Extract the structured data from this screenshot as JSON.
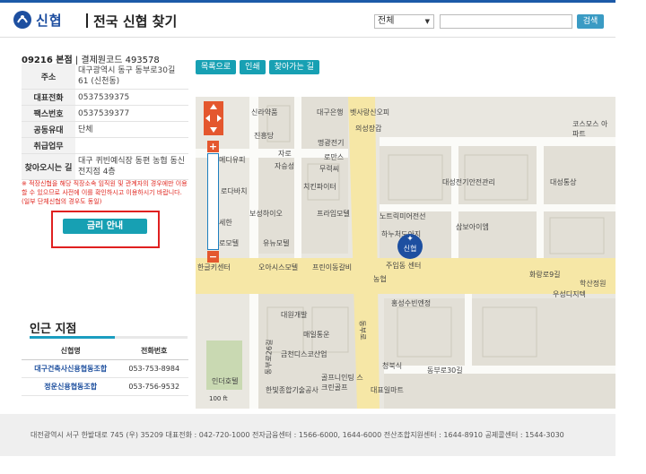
{
  "header": {
    "logo_text": "신협",
    "title": "전국 신협 찾기",
    "select_value": "전체",
    "search_button": "검색",
    "accent": "#1c5aa8"
  },
  "branch": {
    "code": "09216 본점",
    "bank_code_label": "결제원코드 493578",
    "rows": [
      {
        "key": "주소",
        "value": "대구광역시 동구 동부로30길 61 (신천동)"
      },
      {
        "key": "대표전화",
        "value": "0537539375"
      },
      {
        "key": "팩스번호",
        "value": "0537539377"
      },
      {
        "key": "공동유대",
        "value": "단체"
      },
      {
        "key": "취급업무",
        "value": ""
      },
      {
        "key": "찾아오시는 길",
        "value": "대구 퀴빈예식장 동편 농협 동신 전지점 4층"
      }
    ],
    "notice": "※ 적장신협을 해당 직장소속 임직원 및 관계자의 경우에만 이용할 수 있으므로 사전에 이를 확인하시고 이용하시기 바랍니다. (일부 단체신협의 경우도 동일)",
    "rate_button": "금리 안내"
  },
  "nearby": {
    "title": "인근 지점",
    "headers": [
      "신협명",
      "전화번호"
    ],
    "rows": [
      {
        "name": "대구건축사신용협동조합",
        "phone": "053-753-8984"
      },
      {
        "name": "정운신용협동조합",
        "phone": "053-756-9532"
      }
    ]
  },
  "map": {
    "buttons": [
      "목록으로",
      "인쇄",
      "찾아가는 길"
    ],
    "marker_text": "신협",
    "scale": "100 ft",
    "labels": [
      "대구은행",
      "벳사랑신오피",
      "의성장갑",
      "명광전기",
      "대성전기안전관리",
      "대성통상",
      "코스모스 아파트",
      "치킨파이터",
      "노트릭미어전선",
      "하누처도아지",
      "삼보아이엠",
      "농협",
      "홍성수빈엔정",
      "우성디지텍",
      "학산정원",
      "대원개발",
      "매일통운",
      "금천디스코산업",
      "골프니인팅 스크린골프",
      "한빛종합기술공사",
      "청북식",
      "대표일마트",
      "인더호텔",
      "유뉴모텔",
      "보성하이오",
      "오아시스모텔",
      "프린이동갈비",
      "진흥당",
      "자승성",
      "무력씨",
      "동부로30길",
      "화랑로9길",
      "동부로26길",
      "동부로",
      "세한",
      "로모텔",
      "한글키센터",
      "신라약품",
      "자로",
      "로만스",
      "메디유피",
      "프라임모텔",
      "주입동 센터",
      "로다바치"
    ]
  },
  "footer": {
    "text": "대전광역시 서구 한밭대로 745 (우) 35209 대표전화 : 042-720-1000 전자금융센터 : 1566-6000, 1644-6000 전산조합지원센터 : 1644-8910 공제콜센터 : 1544-3030"
  }
}
